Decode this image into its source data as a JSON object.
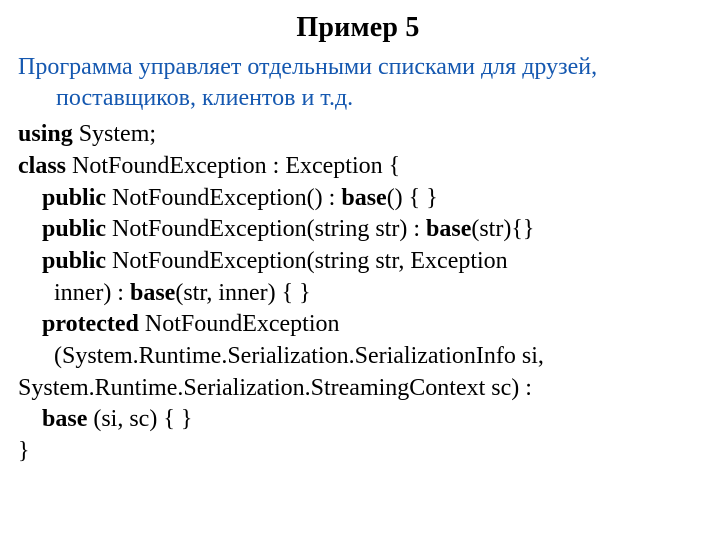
{
  "title": "Пример 5",
  "desc": {
    "line1": "Программа управляет отдельными списками для друзей,",
    "line2": "поставщиков, клиентов и т.д."
  },
  "kw": {
    "using": "using",
    "class": "class",
    "public": "public",
    "protected": "protected",
    "base": "base"
  },
  "code": {
    "system": " System;",
    "classDecl": " NotFoundException : Exception {",
    "ctor0_a": " NotFoundException() : ",
    "ctor0_b": "() { }",
    "ctor1_a": " NotFoundException(string str) : ",
    "ctor1_b": "(str){}",
    "ctor2_a": " NotFoundException(string str, Exception",
    "ctor2_inner_a": " inner) : ",
    "ctor2_inner_b": "(str, inner) { }",
    "ctor3_a": " NotFoundException",
    "ctor3_params": " (System.Runtime.Serialization.SerializationInfo si,",
    "ctor3_sc": "System.Runtime.Serialization.StreamingContext sc) :",
    "ctor3_base_args": " (si, sc) { }",
    "closing": "}"
  }
}
